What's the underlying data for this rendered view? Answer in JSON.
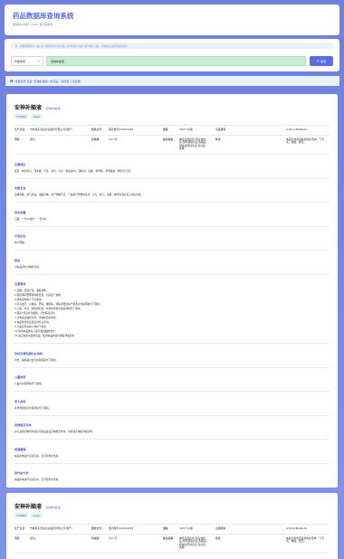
{
  "header": {
    "title": "药品数据库查询系统",
    "subtitle": "数据库共收录 11667 条药品信息"
  },
  "search": {
    "tip": "智能搜索提示：输入多个关键词用空格分隔，如\"布洛芬 头痛\" 或\"胃痛 儿童\"，系统会自动匹配最佳结果",
    "select_value": "智能搜索",
    "query": "安神补脑液",
    "button_label": "搜索"
  },
  "result_text": "智能搜索 包含 \"安神补脑液\" 的药品，共找到 7 条结果",
  "cards": [
    {
      "name": "安神补脑液",
      "tag": "(安神补脑液)",
      "badges": [
        "OTC甲类",
        "中成药"
      ],
      "row1": {
        "l1": "生产企业",
        "v1": "吉林敖东延边药业股份有限公司(国产)",
        "l2": "批准文号",
        "v2": "国药准字Z22022463",
        "l3": "规格",
        "v3": "10ml*10瓶",
        "l4": "汉语拼音",
        "v4": "AnShenBuNaoYe"
      },
      "row2": {
        "l1": "剂型",
        "v1": "液剂。",
        "l2": "有效期",
        "v2": "24个月",
        "l3": "相关疾病",
        "v3": "神经衰弱症状;有症状的后;更年期综合征;失眠症;慢性疲劳综合征;焦虑症;失眠",
        "l4": "性状",
        "v4": "本品为黄色至棕黄色的液体；气芳香，味甜、微苦。"
      },
      "sections": [
        {
          "title": "主要成份",
          "body": "鹿茸、制何首乌、淫羊藿、干姜、甘草、大枣、维生素B1。辅料为：蔗糖、苯甲酸、苯甲酸钠、枸杞苷/乙醇。"
        },
        {
          "title": "功能主治",
          "body": "生精补髓，益气养血，强脑安神。用于肾精不足、气血两亏所致的头晕、乏力、健忘、失眠；神经衰弱症见上述证候者。"
        },
        {
          "title": "用法用量",
          "body": "口服。一次10毫升，一日2次。"
        },
        {
          "title": "不良反应",
          "body": "尚不明确。"
        },
        {
          "title": "禁忌",
          "body": "对本品成分过敏者禁用。"
        },
        {
          "title": "注意事项",
          "body": "1.忌烟、酒及辛辣、油腻食物。\n2.服药期间要保持情绪乐观，切忌生气恼怒。\n3.感冒发热病人不宜服用。\n4.有高血压、心脏病、肝病、糖尿病、肾病等慢性病严重者应在医师指导下服用。\n5.儿童、孕妇、哺乳期妇女、年老体弱者应在医师指导下服用。\n6.服药7天症状无缓解，应去医院就诊。\n7.对本品过敏者禁用，过敏体质者慎用。\n8.本品性状发生改变时禁止使用。\n9.儿童必须在成人监护下使用。\n10.请将本品放在儿童不能接触的地方。\n11.如正在使用其他药品，使用本品前请咨询医师或药师。"
        },
        {
          "title": "孕妇及哺乳期妇女用药",
          "body": "孕妇、哺乳期妇女应在医师指导下服用。"
        },
        {
          "title": "儿童用药",
          "body": "儿童应在医师指导下服用。"
        },
        {
          "title": "老人用药",
          "body": "年老体弱者应在医师指导下服用。"
        },
        {
          "title": "药物相互作用",
          "body": "如与其他药物同时使用可能会发生药物相互作用，详情请咨询医师或药师。"
        },
        {
          "title": "药理毒理",
          "body": "本品尚未进行该项实验，无可靠参考文献。"
        },
        {
          "title": "药代动力学",
          "body": "本品尚未进行该项实验，无可靠参考文献。"
        }
      ]
    },
    {
      "name": "安神补脑液",
      "tag": "(安神补脑液)",
      "badges": [
        "OTC甲类",
        "中成药"
      ],
      "row1": {
        "l1": "生产企业",
        "v1": "吉林敖东延边药业股份有限公司(国产)",
        "l2": "批准文号",
        "v2": "国药准字Z22022463",
        "l3": "规格",
        "v3": "10ml*12瓶",
        "l4": "汉语拼音",
        "v4": "AnShenBuNaoYe"
      },
      "row2": {
        "l1": "剂型",
        "v1": "液剂。",
        "l2": "有效期",
        "v2": "24个月",
        "l3": "相关疾病",
        "v3": "神经衰弱症状;有症状的后;更年期综合征;失眠症;慢性疲劳综合征;焦虑症;失眠",
        "l4": "性状",
        "v4": "本品为黄色至棕黄色的液体；气芳香，味甜、微苦。"
      }
    }
  ],
  "colors": {
    "accent": "#5b6ee0",
    "background": "#7486e4",
    "search_input_bg": "#c8ecd1"
  }
}
